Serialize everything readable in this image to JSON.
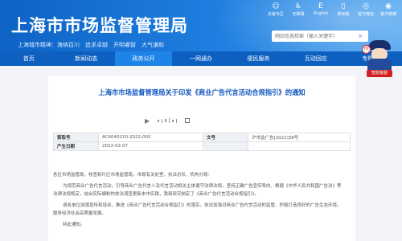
{
  "site": {
    "title": "上海市市场监督管理局",
    "spirit": "上海城市精神：海纳百川　追求卓越　开明睿智　大气谦和"
  },
  "toplinks": [
    {
      "icon": "elder-icon",
      "label": "长者专区"
    },
    {
      "icon": "accessibility-icon",
      "label": "无障碍"
    },
    {
      "icon": "english-icon",
      "label": "English"
    },
    {
      "icon": "mobile-icon",
      "label": "移动端"
    },
    {
      "icon": "wechat-icon",
      "label": "官方微信"
    },
    {
      "icon": "weibo-icon",
      "label": "官方微博"
    }
  ],
  "search": {
    "placeholder": "网站信息检索（输入关键字）"
  },
  "nav": {
    "items": [
      "首页",
      "新闻动态",
      "政务公开",
      "一网通办",
      "便民服务",
      "互动回应",
      "专题专栏"
    ],
    "active_index": 2
  },
  "mascot": {
    "badge": "智能客服",
    "bubble": "Hi"
  },
  "document": {
    "title": "上海市市场监督管理局关于印发《商业广告代言活动合规指引》的通知",
    "meta": [
      {
        "k1": "索取号",
        "v1": "AC6040210-2022-002",
        "k2": "文号",
        "v2": "沪市监广告[2022]38号"
      },
      {
        "k1": "产生日期",
        "v1": "2022-02-07",
        "k2": "",
        "v2": ""
      }
    ],
    "paragraphs": [
      "各区市场监管局，核查新片区市场监管局，市局有关处室、执法总队、机构分局：",
      "为规范商业广告代言活动，引导商业广告代言人及代言活动相关主体遵守法律法规，坚持正确广告宣传导向，根据《中华人民共和国广告法》等法律法规规定，结合实际编制的依法调查更新本市实践，我局研究制定了《商业广告代言活动合规指引》。",
      "请各单位加强宣传和培训，推进《商业广告代言活动合规指引》的落实，依法加强对商业广告代言活动的监管，积极打造良好的广告生态环境，服务经济社会高质量发展。",
      "特此通知。"
    ]
  },
  "colors": {
    "header": "#0e63c5",
    "nav": "#0d5fc0",
    "nav_active": "#1e84e8",
    "title": "#1356c0"
  }
}
